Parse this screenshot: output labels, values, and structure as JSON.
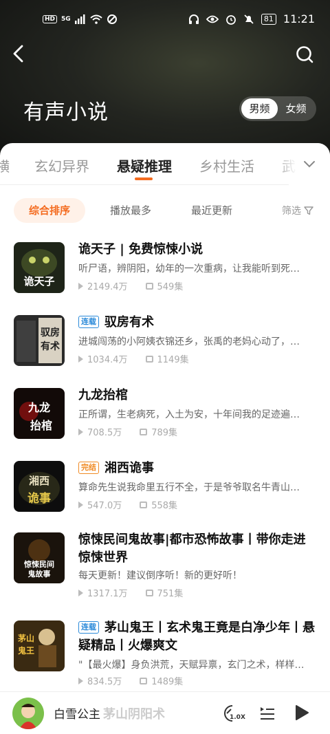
{
  "status_bar": {
    "hd": "HD",
    "network": "5G",
    "battery": "81",
    "time": "11:21"
  },
  "header": {
    "title": "有声小说",
    "gender_tabs": [
      "男频",
      "女频"
    ],
    "active_gender": "男频"
  },
  "category_tabs": [
    "横",
    "玄幻异界",
    "悬疑推理",
    "乡村生活",
    "武"
  ],
  "active_category": "悬疑推理",
  "sort_options": [
    "综合排序",
    "播放最多",
    "最近更新"
  ],
  "filter_label": "筛选",
  "books": [
    {
      "title": "诡天子 | 免费惊悚小说",
      "badge": "",
      "description": "听尸语，辨阴阳，幼年的一次重病，让我能听到死…",
      "plays": "2149.4万",
      "episodes": "549集",
      "cover_text": "诡天子"
    },
    {
      "title": "驭房有术",
      "badge": "连载",
      "description": "进城闯荡的小阿姨衣锦还乡，张禹的老妈心动了，…",
      "plays": "1034.4万",
      "episodes": "1149集",
      "cover_text": "驭房有术"
    },
    {
      "title": "九龙抬棺",
      "badge": "",
      "description": "正所谓，生老病死，入土为安，十年间我的足迹遍…",
      "plays": "708.5万",
      "episodes": "789集",
      "cover_text": "九龙抬棺"
    },
    {
      "title": "湘西诡事",
      "badge": "完结",
      "description": "算命先生说我命里五行不全，于是爷爷取名牛青山…",
      "plays": "547.0万",
      "episodes": "558集",
      "cover_text": "湘西诡事"
    },
    {
      "title": "惊悚民间鬼故事|都市恐怖故事丨带你走进惊悚世界",
      "badge": "",
      "description": "每天更新！建议倒序听！新的更好听！",
      "plays": "1317.1万",
      "episodes": "751集",
      "cover_text": "惊悚民间鬼故事"
    },
    {
      "title": "茅山鬼王丨玄术鬼王竟是白净少年丨悬疑精品丨火爆爽文",
      "badge": "连载",
      "description": "\"【最火爆】身负洪荒，天赋异禀，玄门之术，样样…",
      "plays": "834.5万",
      "episodes": "1489集",
      "cover_text": "茅山鬼王"
    }
  ],
  "next_title_peek": "茅山阴阳术",
  "player": {
    "title": "白雪公主",
    "speed": "1.0X"
  },
  "colors": {
    "accent": "#f46b1f",
    "serial_badge": "#2b8ad9",
    "done_badge": "#f08a24"
  }
}
